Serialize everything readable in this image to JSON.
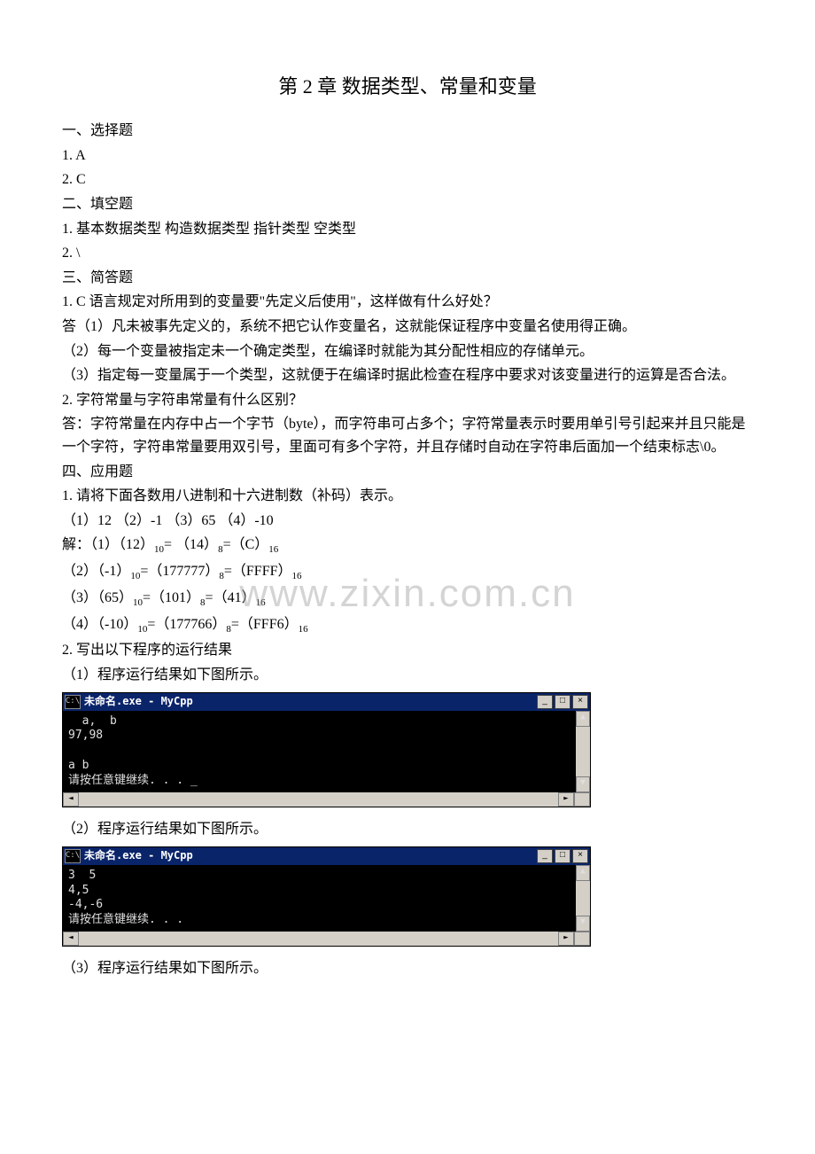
{
  "title": "第 2 章   数据类型、常量和变量",
  "section1": {
    "heading": "一、选择题",
    "q1": "1. A",
    "q2": "2. C"
  },
  "section2": {
    "heading": "二、填空题",
    "line1": "1.  基本数据类型        构造数据类型        指针类型        空类型",
    "line2": "2. \\"
  },
  "section3": {
    "heading": "三、简答题",
    "q1": "1. C 语言规定对所用到的变量要\"先定义后使用\"，这样做有什么好处？",
    "a1_1": "答（1）凡未被事先定义的，系统不把它认作变量名，这就能保证程序中变量名使用得正确。",
    "a1_2": "（2）每一个变量被指定未一个确定类型，在编译时就能为其分配性相应的存储单元。",
    "a1_3": "（3）指定每一变量属于一个类型，这就便于在编译时据此检查在程序中要求对该变量进行的运算是否合法。",
    "q2": "2.  字符常量与字符串常量有什么区别？",
    "a2": "答：字符常量在内存中占一个字节（byte），而字符串可占多个；字符常量表示时要用单引号引起来并且只能是一个字符，字符串常量要用双引号，里面可有多个字符，并且存储时自动在字符串后面加一个结束标志\\0。"
  },
  "section4": {
    "heading": "四、应用题",
    "q1": "1.  请将下面各数用八进制和十六进制数（补码）表示。",
    "q1_items": "（1）12            （2）-1                （3）65               （4）-10",
    "sol_label": "解：",
    "sol1": {
      "pre": "（1）（12）",
      "s1": "10",
      "mid1": "= （14）",
      "s2": "8",
      "mid2": "=（C）",
      "s3": "16"
    },
    "sol2": {
      "pre": "（2）（-1）",
      "s1": "10",
      "mid1": "=（177777）",
      "s2": "8",
      "mid2": "=（FFFF）",
      "s3": "16"
    },
    "sol3": {
      "pre": "（3）（65）",
      "s1": "10",
      "mid1": "=（101）",
      "s2": "8",
      "mid2": "=（41）",
      "s3": "16"
    },
    "sol4": {
      "pre": "（4）（-10）",
      "s1": "10",
      "mid1": "=（177766）",
      "s2": "8",
      "mid2": "=（FFF6）",
      "s3": "16"
    },
    "q2": "2.  写出以下程序的运行结果",
    "r1_label": "（1）程序运行结果如下图所示。",
    "r2_label": "（2）程序运行结果如下图所示。",
    "r3_label": "（3）程序运行结果如下图所示。"
  },
  "console1": {
    "title": "未命名.exe - MyCpp",
    "icon": "C:\\",
    "content": "  a,  b\n97,98\n\na b\n请按任意键继续. . . _"
  },
  "console2": {
    "title": "未命名.exe - MyCpp",
    "icon": "C:\\",
    "content": "3  5\n4,5\n-4,-6\n请按任意键继续. . ."
  },
  "winbtns": {
    "min": "_",
    "max": "□",
    "close": "×",
    "up": "▲",
    "down": "▼",
    "left": "◄",
    "right": "►"
  },
  "watermark": "www.zixin.com.cn"
}
